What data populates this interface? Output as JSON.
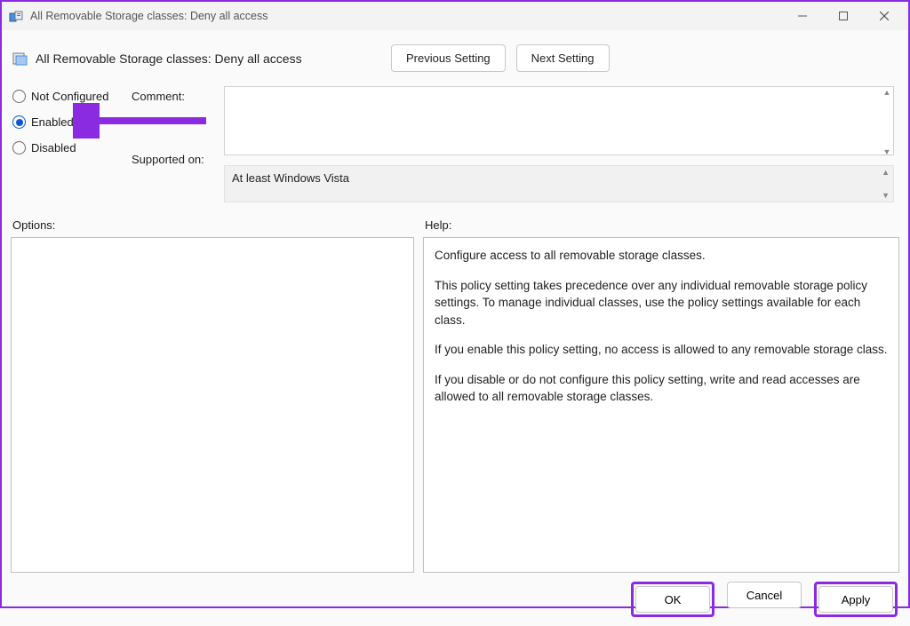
{
  "window": {
    "title": "All Removable Storage classes: Deny all access"
  },
  "header": {
    "title": "All Removable Storage classes: Deny all access",
    "prev_button": "Previous Setting",
    "next_button": "Next Setting"
  },
  "state": {
    "options": [
      {
        "label": "Not Configured",
        "selected": false
      },
      {
        "label": "Enabled",
        "selected": true
      },
      {
        "label": "Disabled",
        "selected": false
      }
    ],
    "comment_label": "Comment:",
    "comment_value": "",
    "supported_label": "Supported on:",
    "supported_value": "At least Windows Vista"
  },
  "sections": {
    "options_label": "Options:",
    "help_label": "Help:"
  },
  "help": {
    "p1": "Configure access to all removable storage classes.",
    "p2": "This policy setting takes precedence over any individual removable storage policy settings. To manage individual classes, use the policy settings available for each class.",
    "p3": "If you enable this policy setting, no access is allowed to any removable storage class.",
    "p4": "If you disable or do not configure this policy setting, write and read accesses are allowed to all removable storage classes."
  },
  "footer": {
    "ok": "OK",
    "cancel": "Cancel",
    "apply": "Apply"
  }
}
